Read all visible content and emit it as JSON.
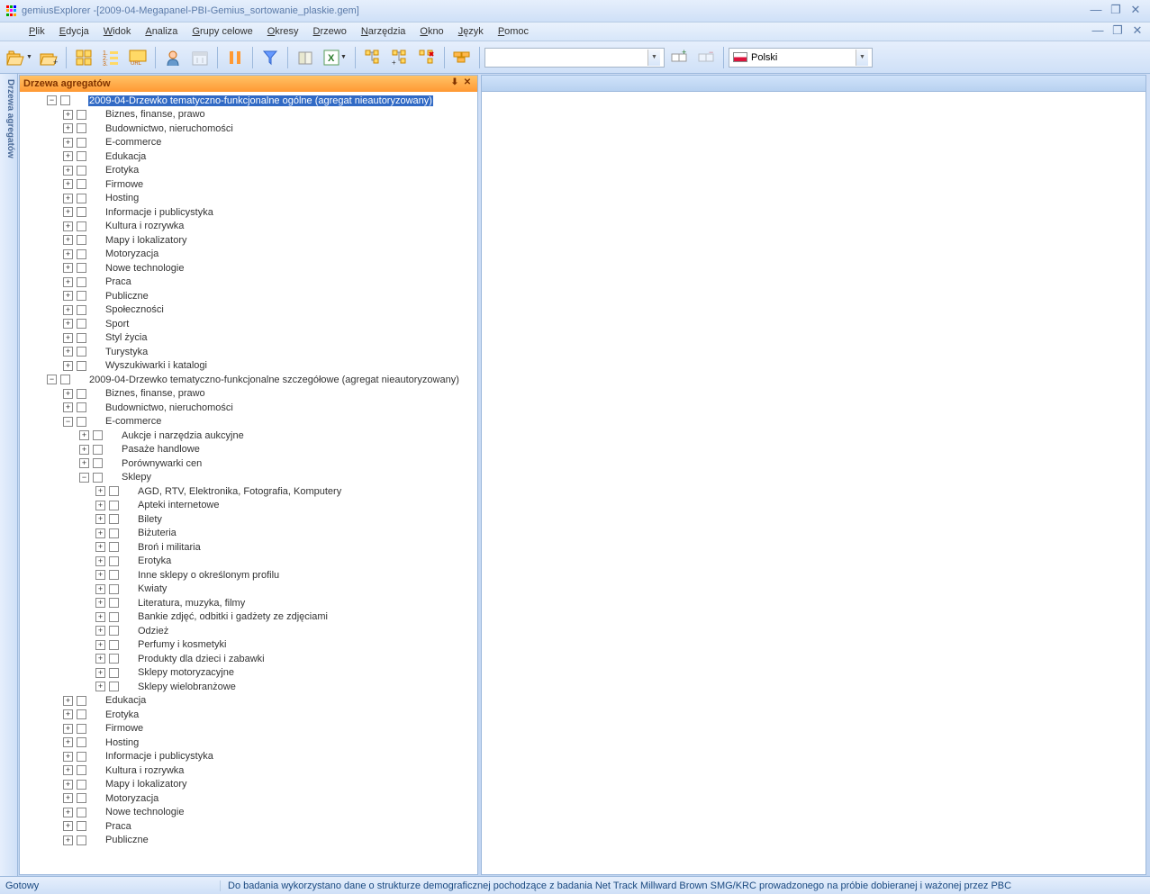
{
  "app": {
    "title_app": "gemiusExplorer - ",
    "title_doc": "[2009-04-Megapanel-PBI-Gemius_sortowanie_plaskie.gem]"
  },
  "menu": {
    "items": [
      "Plik",
      "Edycja",
      "Widok",
      "Analiza",
      "Grupy celowe",
      "Okresy",
      "Drzewo",
      "Narzędzia",
      "Okno",
      "Język",
      "Pomoc"
    ]
  },
  "combo": {
    "language": "Polski"
  },
  "panel": {
    "title": "Drzewa agregatów"
  },
  "side_tab": "Drzewa agregatów",
  "tree": [
    {
      "d": 0,
      "e": "-",
      "s": true,
      "t": "2009-04-Drzewko tematyczno-funkcjonalne ogólne (agregat nieautoryzowany)"
    },
    {
      "d": 1,
      "e": "+",
      "t": "Biznes, finanse, prawo"
    },
    {
      "d": 1,
      "e": "+",
      "t": "Budownictwo, nieruchomości"
    },
    {
      "d": 1,
      "e": "+",
      "t": "E-commerce"
    },
    {
      "d": 1,
      "e": "+",
      "t": "Edukacja"
    },
    {
      "d": 1,
      "e": "+",
      "t": "Erotyka"
    },
    {
      "d": 1,
      "e": "+",
      "t": "Firmowe"
    },
    {
      "d": 1,
      "e": "+",
      "t": "Hosting"
    },
    {
      "d": 1,
      "e": "+",
      "t": "Informacje i publicystyka"
    },
    {
      "d": 1,
      "e": "+",
      "t": "Kultura i rozrywka"
    },
    {
      "d": 1,
      "e": "+",
      "t": "Mapy i lokalizatory"
    },
    {
      "d": 1,
      "e": "+",
      "t": "Motoryzacja"
    },
    {
      "d": 1,
      "e": "+",
      "t": "Nowe technologie"
    },
    {
      "d": 1,
      "e": "+",
      "t": "Praca"
    },
    {
      "d": 1,
      "e": "+",
      "t": "Publiczne"
    },
    {
      "d": 1,
      "e": "+",
      "t": "Społeczności"
    },
    {
      "d": 1,
      "e": "+",
      "t": "Sport"
    },
    {
      "d": 1,
      "e": "+",
      "t": "Styl życia"
    },
    {
      "d": 1,
      "e": "+",
      "t": "Turystyka"
    },
    {
      "d": 1,
      "e": "+",
      "t": "Wyszukiwarki i katalogi"
    },
    {
      "d": 0,
      "e": "-",
      "t": "2009-04-Drzewko tematyczno-funkcjonalne szczegółowe (agregat nieautoryzowany)"
    },
    {
      "d": 1,
      "e": "+",
      "t": "Biznes, finanse, prawo"
    },
    {
      "d": 1,
      "e": "+",
      "t": "Budownictwo, nieruchomości"
    },
    {
      "d": 1,
      "e": "-",
      "t": "E-commerce"
    },
    {
      "d": 2,
      "e": "+",
      "t": "Aukcje i narzędzia aukcyjne"
    },
    {
      "d": 2,
      "e": "+",
      "t": "Pasaże handlowe"
    },
    {
      "d": 2,
      "e": "+",
      "t": "Porównywarki cen"
    },
    {
      "d": 2,
      "e": "-",
      "t": "Sklepy"
    },
    {
      "d": 3,
      "e": "+",
      "t": "AGD, RTV, Elektronika, Fotografia, Komputery"
    },
    {
      "d": 3,
      "e": "+",
      "t": "Apteki internetowe"
    },
    {
      "d": 3,
      "e": "+",
      "t": "Bilety"
    },
    {
      "d": 3,
      "e": "+",
      "t": "Biżuteria"
    },
    {
      "d": 3,
      "e": "+",
      "t": "Broń i militaria"
    },
    {
      "d": 3,
      "e": "+",
      "t": "Erotyka"
    },
    {
      "d": 3,
      "e": "+",
      "t": "Inne sklepy o określonym profilu"
    },
    {
      "d": 3,
      "e": "+",
      "t": "Kwiaty"
    },
    {
      "d": 3,
      "e": "+",
      "t": "Literatura, muzyka, filmy"
    },
    {
      "d": 3,
      "e": "+",
      "t": "Bankie zdjęć, odbitki i gadżety ze zdjęciami"
    },
    {
      "d": 3,
      "e": "+",
      "t": "Odzież"
    },
    {
      "d": 3,
      "e": "+",
      "t": "Perfumy i kosmetyki"
    },
    {
      "d": 3,
      "e": "+",
      "t": "Produkty dla dzieci i zabawki"
    },
    {
      "d": 3,
      "e": "+",
      "t": "Sklepy motoryzacyjne"
    },
    {
      "d": 3,
      "e": "+",
      "t": "Sklepy wielobranżowe"
    },
    {
      "d": 1,
      "e": "+",
      "t": "Edukacja"
    },
    {
      "d": 1,
      "e": "+",
      "t": "Erotyka"
    },
    {
      "d": 1,
      "e": "+",
      "t": "Firmowe"
    },
    {
      "d": 1,
      "e": "+",
      "t": "Hosting"
    },
    {
      "d": 1,
      "e": "+",
      "t": "Informacje i publicystyka"
    },
    {
      "d": 1,
      "e": "+",
      "t": "Kultura i rozrywka"
    },
    {
      "d": 1,
      "e": "+",
      "t": "Mapy i lokalizatory"
    },
    {
      "d": 1,
      "e": "+",
      "t": "Motoryzacja"
    },
    {
      "d": 1,
      "e": "+",
      "t": "Nowe technologie"
    },
    {
      "d": 1,
      "e": "+",
      "t": "Praca"
    },
    {
      "d": 1,
      "e": "+",
      "t": "Publiczne"
    }
  ],
  "status": {
    "left": "Gotowy",
    "right": "Do badania wykorzystano dane o strukturze demograficznej pochodzące z badania Net Track Millward Brown SMG/KRC prowadzonego na próbie dobieranej i ważonej przez PBC"
  }
}
